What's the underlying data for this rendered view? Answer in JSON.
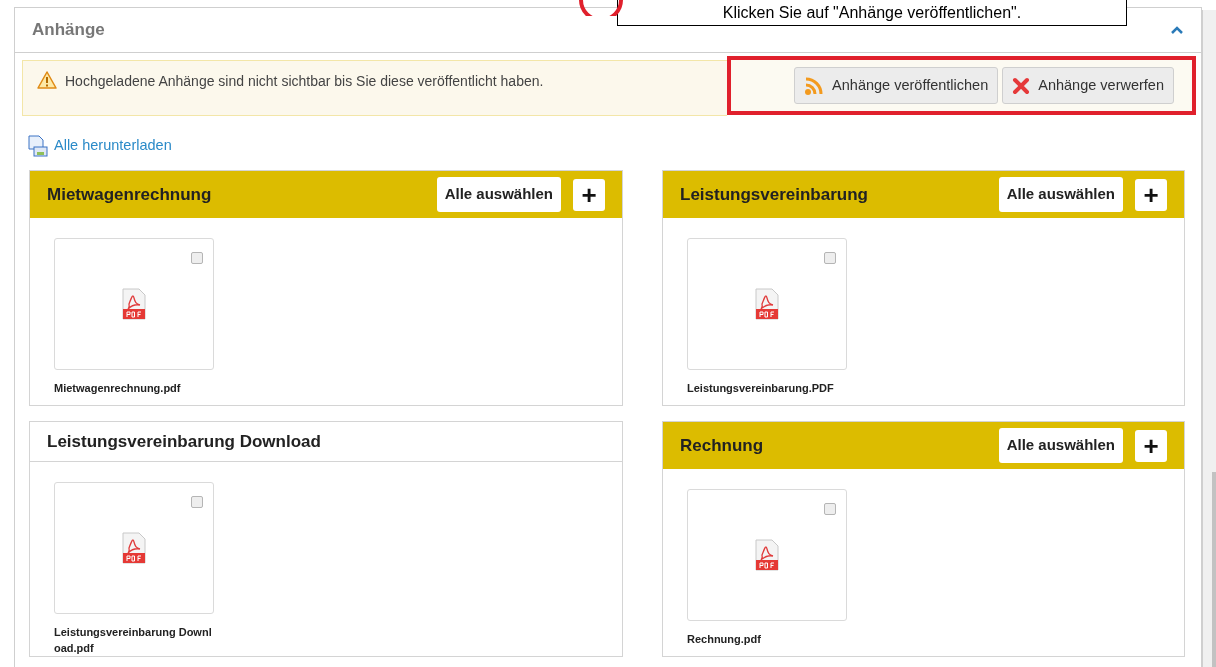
{
  "callout": {
    "text": "Klicken Sie auf \"Anhänge veröffentlichen\"."
  },
  "panel": {
    "title": "Anhänge",
    "expanded": true
  },
  "warning": {
    "text": "Hochgeladene Anhänge sind nicht sichtbar bis Sie diese veröffentlicht haben."
  },
  "actions": [
    {
      "kind": "publish",
      "label": "Anhänge veröffentlichen"
    },
    {
      "kind": "discard",
      "label": "Anhänge verwerfen"
    }
  ],
  "download_all": "Alle herunterladen",
  "groups": [
    {
      "title": "Mietwagenrechnung",
      "highlighted": true,
      "select_all": "Alle auswählen",
      "add": "+",
      "files": [
        {
          "name": "Mietwagenrechnung.pdf",
          "checked": false
        }
      ]
    },
    {
      "title": "Leistungsvereinbarung",
      "highlighted": true,
      "select_all": "Alle auswählen",
      "add": "+",
      "files": [
        {
          "name": "Leistungsvereinbarung.PDF",
          "checked": false
        }
      ]
    },
    {
      "title": "Leistungsvereinbarung Download",
      "highlighted": false,
      "files": [
        {
          "name": "Leistungsvereinbarung Download.pdf",
          "checked": false
        }
      ]
    },
    {
      "title": "Rechnung",
      "highlighted": true,
      "select_all": "Alle auswählen",
      "add": "+",
      "files": [
        {
          "name": "Rechnung.pdf",
          "checked": false
        }
      ]
    }
  ]
}
